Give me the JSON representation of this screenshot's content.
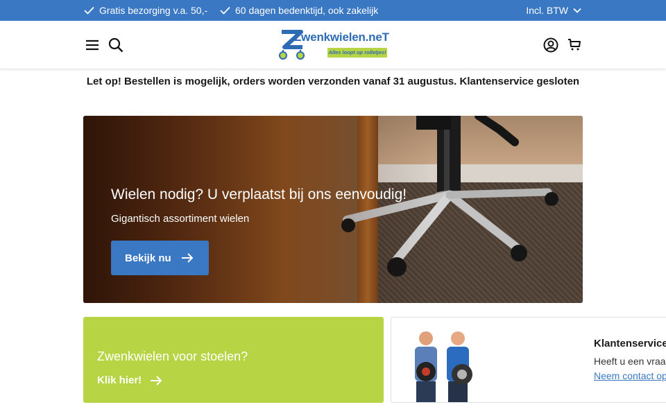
{
  "topbar": {
    "usp_1": "Gratis bezorging v.a. 50,-",
    "usp_2": "60 dagen bedenktijd, ook zakelijk",
    "vat_selector": "Incl. BTW",
    "color": "#3a78c3"
  },
  "header": {
    "logo_text": "Zwenkwielen.neT",
    "logo_tagline": "Alles loopt op rolletjes!",
    "icons": [
      "menu-icon",
      "search-icon",
      "account-icon",
      "cart-icon"
    ]
  },
  "notice": "Let op! Bestellen is mogelijk, orders worden verzonden vanaf 31 augustus. Klantenservice gesloten",
  "hero": {
    "title": "Wielen nodig? U verplaatst bij ons eenvoudig!",
    "subtitle": "Gigantisch assortiment wielen",
    "cta_label": "Bekijk nu"
  },
  "promo": {
    "title": "Zwenkwielen voor stoelen?",
    "link_label": "Klik hier!",
    "color": "#b6d443"
  },
  "service": {
    "title": "Klantenservice",
    "text": "Heeft u een vraag?",
    "contact_link": "Neem contact op"
  }
}
